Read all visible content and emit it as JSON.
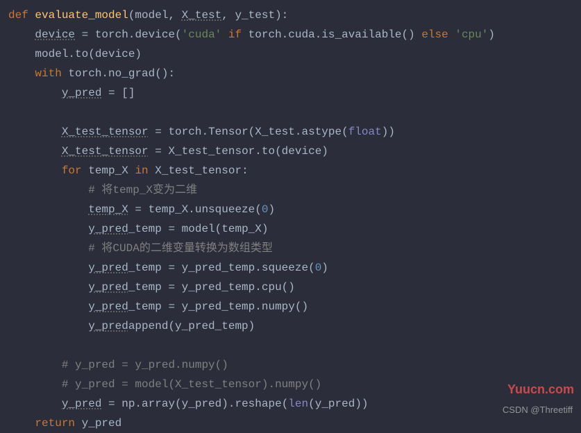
{
  "code": {
    "l1": {
      "def": "def ",
      "fn": "evaluate_model",
      "p1": "(model, ",
      "p2": "X_test",
      "p3": ", y_test):"
    },
    "l2": {
      "i": "    ",
      "v": "device",
      "eq": " = torch.",
      "m": "device",
      "p": "(",
      "s1": "'cuda'",
      "if": " if ",
      "t": "torch.cuda.",
      "av": "is_available",
      "pp": "() ",
      "el": "else ",
      "s2": "'cpu'",
      "cp": ")"
    },
    "l3": {
      "i": "    ",
      "t": "model.",
      "to": "to",
      "p": "(device)"
    },
    "l4": {
      "i": "    ",
      "w": "with ",
      "t": "torch.",
      "ng": "no_grad",
      "p": "():"
    },
    "l5": {
      "i": "        ",
      "v": "y_pred",
      "eq": " = []"
    },
    "l6": "",
    "l7": {
      "i": "        ",
      "v": "X_test_tensor",
      "eq": " = torch.",
      "tn": "Tensor",
      "p": "(X_test.",
      "as": "astype",
      "pp": "(",
      "fl": "float",
      "cp": "))"
    },
    "l8": {
      "i": "        ",
      "v": "X_test_tensor",
      "eq": " = X_test_tensor.",
      "to": "to",
      "p": "(device)"
    },
    "l9": {
      "i": "        ",
      "for": "for ",
      "tx": "temp_X ",
      "in": "in ",
      "xt": "X_test_tensor:"
    },
    "l10": {
      "i": "            ",
      "c": "# 将temp_X变为二维"
    },
    "l11": {
      "i": "            ",
      "v": "temp_X",
      "eq": " = temp_X.",
      "u": "unsqueeze",
      "p": "(",
      "n": "0",
      "cp": ")"
    },
    "l12": {
      "i": "            ",
      "v": "y_pred",
      "t": "_temp = ",
      "m": "model",
      "p": "(temp_X)"
    },
    "l13": {
      "i": "            ",
      "c": "# 将CUDA的二维变量转换为数组类型"
    },
    "l14": {
      "i": "            ",
      "v": "y_pred",
      "t": "_temp = y_pred_temp.",
      "sq": "squeeze",
      "p": "(",
      "n": "0",
      "cp": ")"
    },
    "l15": {
      "i": "            ",
      "v": "y_pred",
      "t": "_temp = y_pred_temp.",
      "c": "cpu",
      "p": "()"
    },
    "l16": {
      "i": "            ",
      "v": "y_pred",
      "t": "_temp = y_pred_temp.",
      "n": "numpy",
      "p": "()"
    },
    "l17": {
      "i": "            ",
      "v": "y_pred",
      ".": ".",
      "ap": "append",
      "p": "(y_pred_temp)"
    },
    "l18": "",
    "l19": {
      "i": "        ",
      "c": "# y_pred = y_pred.numpy()"
    },
    "l20": {
      "i": "        ",
      "c": "# y_pred = model(X_test_tensor).numpy()"
    },
    "l21": {
      "i": "        ",
      "v": "y_pred",
      "eq": " = np.",
      "ar": "array",
      "p": "(y_pred).",
      "rs": "reshape",
      "pp": "(",
      "ln": "len",
      "ppp": "(y_pred))"
    },
    "l22": {
      "i": "    ",
      "r": "return ",
      "v": "y_pred"
    }
  },
  "watermarks": {
    "site": "Yuucn.com",
    "csdn": "CSDN @Threetiff"
  }
}
